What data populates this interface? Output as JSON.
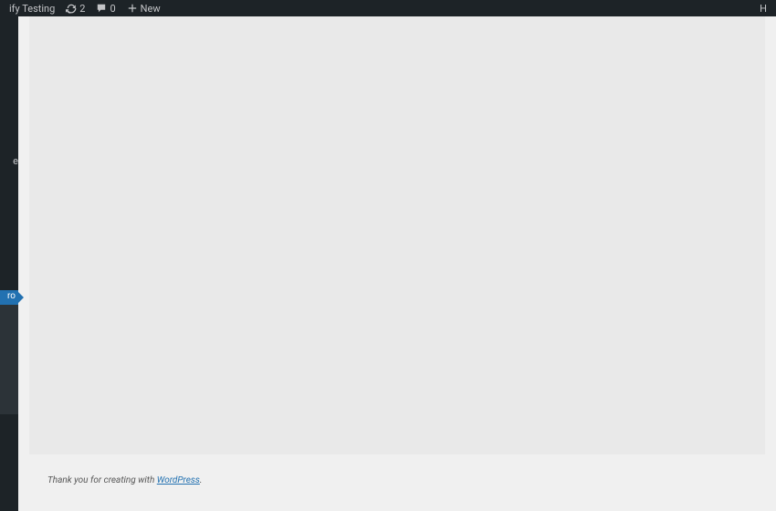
{
  "toolbar": {
    "site_name_suffix": "ify Testing",
    "updates_count": "2",
    "comments_count": "0",
    "new_label": "New",
    "right_text": "H"
  },
  "sidebar": {
    "fragment_1": "e",
    "active_fragment": "ro"
  },
  "footer": {
    "prefix": "Thank you for creating with ",
    "link_text": "WordPress",
    "suffix": "."
  }
}
